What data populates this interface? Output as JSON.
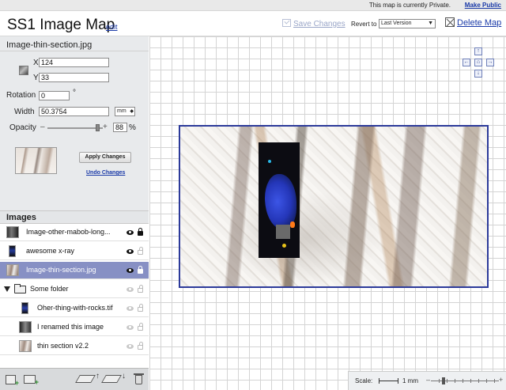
{
  "notice": {
    "text": "This map is currently Private.",
    "link": "Make Public"
  },
  "header": {
    "title": "SS1 Image Map",
    "edit_link": "edit",
    "save_changes": "Save Changes",
    "revert_label": "Revert to",
    "revert_value": "Last Version",
    "delete_map": "Delete Map"
  },
  "properties": {
    "filename": "Image-thin-section.jpg",
    "x_label": "X",
    "x_value": "124",
    "y_label": "Y",
    "y_value": "33",
    "rotation_label": "Rotation",
    "rotation_value": "0",
    "rotation_unit": "°",
    "width_label": "Width",
    "width_value": "50.3754",
    "width_unit": "mm",
    "opacity_label": "Opacity",
    "opacity_value": "88",
    "opacity_unit": "%",
    "opacity_fraction": 0.88,
    "apply_button": "Apply Changes",
    "undo_link": "Undo Changes"
  },
  "images": {
    "title": "Images",
    "items": [
      {
        "name": "Image-other-mabob-long...",
        "visible": true,
        "locked": true,
        "selected": false,
        "indent": false
      },
      {
        "name": "awesome x-ray",
        "visible": true,
        "locked": false,
        "selected": false,
        "indent": false
      },
      {
        "name": "Image-thin-section.jpg",
        "visible": true,
        "locked": true,
        "selected": true,
        "indent": false
      },
      {
        "name": "Some folder",
        "visible": false,
        "locked": false,
        "selected": false,
        "folder": true
      },
      {
        "name": "Oher-thing-with-rocks.tif",
        "visible": false,
        "locked": false,
        "selected": false,
        "indent": true
      },
      {
        "name": "I renamed this image",
        "visible": false,
        "locked": false,
        "selected": false,
        "indent": true
      },
      {
        "name": "thin section v2.2",
        "visible": false,
        "locked": false,
        "selected": false,
        "indent": true
      }
    ]
  },
  "map": {
    "scale_label": "Scale:",
    "scale_value": "1 mm"
  },
  "colors": {
    "accent": "#1a3aa8",
    "selected_row": "#8790c4",
    "image_border": "#2c3a9a"
  }
}
